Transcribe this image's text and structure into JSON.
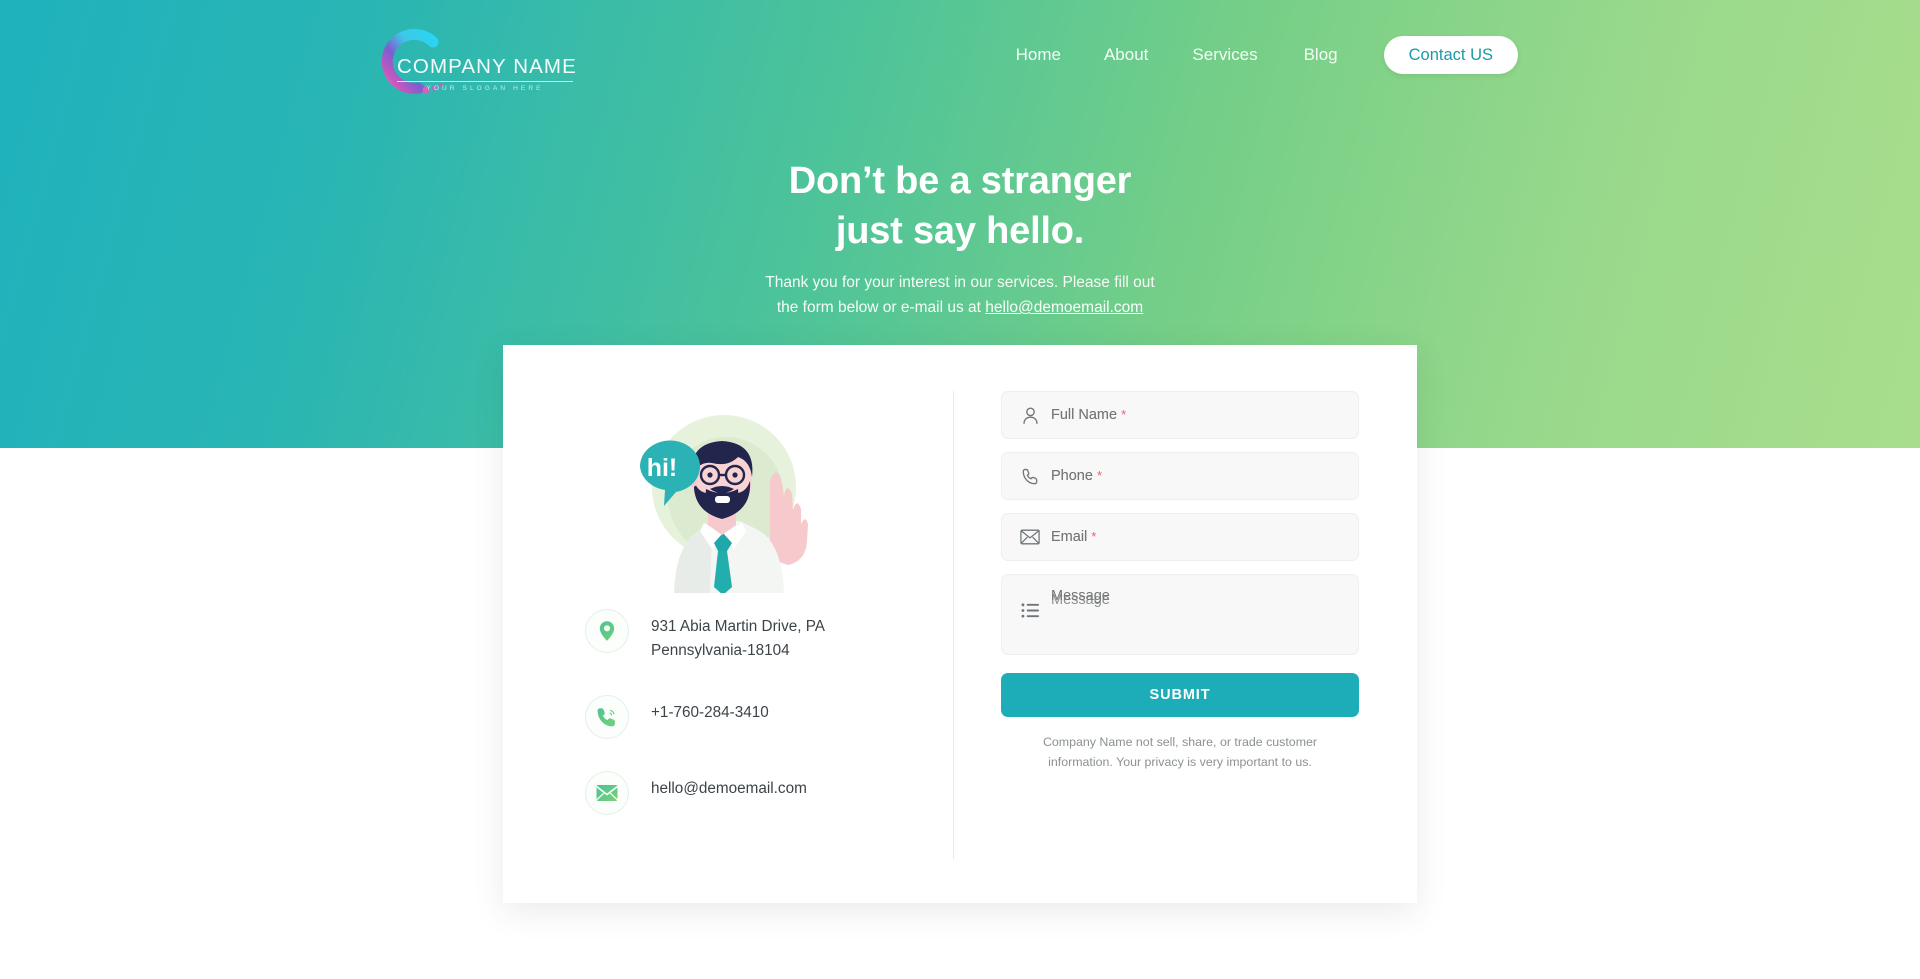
{
  "header": {
    "logo": {
      "name": "COMPANY NAME",
      "slogan": "YOUR SLOGAN HERE",
      "swirl_icon": "swirl-logo-icon"
    },
    "nav_items": [
      {
        "label": "Home"
      },
      {
        "label": "About"
      },
      {
        "label": "Services"
      },
      {
        "label": "Blog"
      }
    ],
    "cta": {
      "label": "Contact US"
    }
  },
  "hero": {
    "title_line_1": "Don’t be a stranger",
    "title_line_2": "just say hello.",
    "sub_line_1": "Thank you for your interest in our services. Please fill out",
    "sub_line_2_prefix": "the form below or e-mail us at",
    "sub_email": "hello@demoemail.com"
  },
  "illustration": {
    "bubble_text": "hi!",
    "name": "waving-man-illustration"
  },
  "contact_info": [
    {
      "icon": "location-pin-icon",
      "line_1": "931  Abia Martin Drive, PA",
      "line_2": "Pennsylvania-18104"
    },
    {
      "icon": "phone-icon",
      "line_1": "+1-760-284-3410",
      "line_2": ""
    },
    {
      "icon": "envelope-icon",
      "line_1": "hello@demoemail.com",
      "line_2": ""
    }
  ],
  "form": {
    "fields": [
      {
        "label": "Full Name",
        "required": "*",
        "icon": "person-icon",
        "placeholder": "Full Name"
      },
      {
        "label": "Phone",
        "required": "*",
        "icon": "phone-outline-icon",
        "placeholder": "Phone"
      },
      {
        "label": "Email",
        "required": "*",
        "icon": "envelope-outline-icon",
        "placeholder": "Email"
      },
      {
        "label": "Message",
        "required": "",
        "icon": "list-icon",
        "placeholder": "Message"
      }
    ],
    "submit_label": "SUBMIT",
    "privacy_line_1": "Company Name not sell, share, or trade customer",
    "privacy_line_2": "information. Your privacy is very important to us."
  },
  "colors": {
    "hero_gradient_start": "#1fb2bd",
    "hero_gradient_end": "#a8de8b",
    "accent_teal": "#1dadb8",
    "cta_text": "#1b9aa8",
    "required_red": "#e8616e"
  }
}
